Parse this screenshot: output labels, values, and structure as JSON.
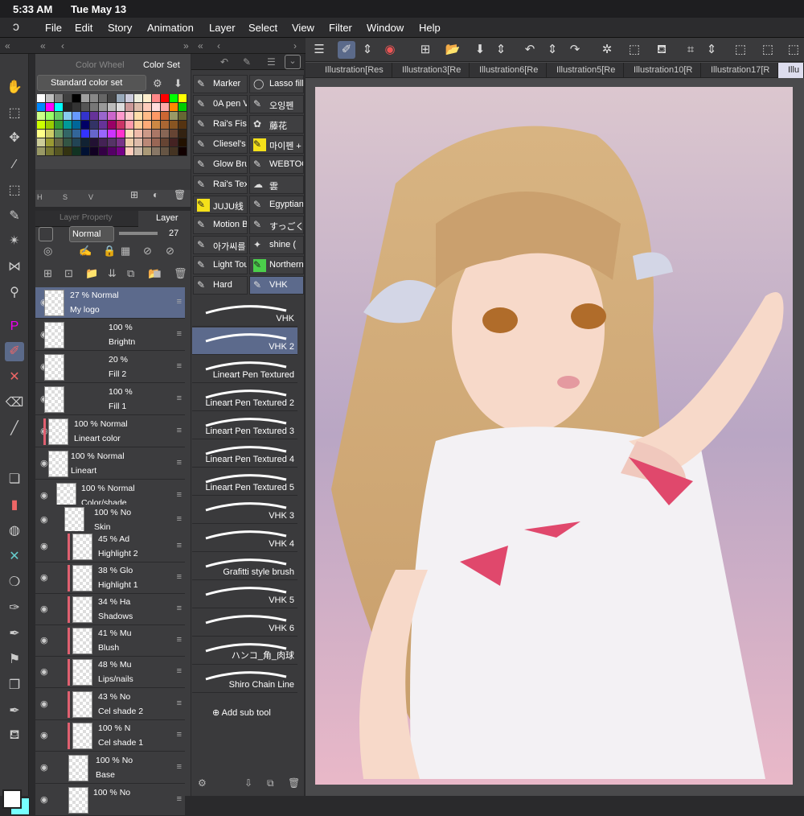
{
  "status": {
    "time": "5:33 AM",
    "date": "Tue May 13"
  },
  "menu": [
    "File",
    "Edit",
    "Story",
    "Animation",
    "Layer",
    "Select",
    "View",
    "Filter",
    "Window",
    "Help"
  ],
  "color_panel": {
    "tabs": [
      {
        "label": "Color Wheel"
      },
      {
        "label": "Color Set"
      }
    ],
    "set_selected": "Standard color set",
    "bottom_labels": [
      "H",
      "S",
      "V"
    ]
  },
  "layer_panel": {
    "tabs": [
      {
        "label": "Layer Property"
      },
      {
        "label": "Layer"
      }
    ],
    "blend_mode": "Normal",
    "opacity": "27",
    "layers": [
      {
        "pct": "27 %  Normal",
        "name": "My logo"
      },
      {
        "pct": "100 %",
        "name": "Brightn"
      },
      {
        "pct": "20 %",
        "name": "Fill 2"
      },
      {
        "pct": "100 %",
        "name": "Fill 1"
      },
      {
        "pct": "100 %  Normal",
        "name": "Lineart color"
      },
      {
        "pct": "100 %  Normal",
        "name": "Lineart"
      },
      {
        "pct": "100 %  Normal",
        "name": "Color/shade"
      },
      {
        "pct": "100 %  No",
        "name": "Skin"
      },
      {
        "pct": "45 %  Ad",
        "name": "Highlight 2"
      },
      {
        "pct": "38 %  Glo",
        "name": "Highlight 1"
      },
      {
        "pct": "34 %  Ha",
        "name": "Shadows"
      },
      {
        "pct": "41 %  Mu",
        "name": "Blush"
      },
      {
        "pct": "48 %  Mu",
        "name": "Lips/nails"
      },
      {
        "pct": "43 %  No",
        "name": "Cel shade 2"
      },
      {
        "pct": "100 %  N",
        "name": "Cel shade 1"
      },
      {
        "pct": "100 %  No",
        "name": "Base"
      },
      {
        "pct": "100 %  No",
        "name": ""
      }
    ]
  },
  "brush_panel": {
    "groups": [
      "Marker",
      "Lasso fill",
      "0A pen V",
      "오잉펜",
      "Rai's Fisl",
      "藤花",
      "Cliesel's",
      "마이펜 +",
      "Glow Bru",
      "WEBTOO",
      "Rai's Tex",
      "雲",
      "JUJU线",
      "Egyptian",
      "Motion B",
      "すっごく",
      "아가씨를",
      "shine (",
      "Light Tou",
      "Northern",
      "Hard",
      "VHK"
    ],
    "strokes": [
      "VHK",
      "VHK 2",
      "Lineart Pen Textured",
      "Lineart Pen Textured 2",
      "Lineart Pen Textured 3",
      "Lineart Pen Textured 4",
      "Lineart Pen Textured 5",
      "VHK 3",
      "VHK 4",
      "Grafitti style brush",
      "VHK 5",
      "VHK 6",
      "ハンコ_角_肉球",
      "Shiro Chain Line"
    ],
    "add_sub_tool": "Add sub tool"
  },
  "doc_tabs": [
    "Illustration[Res",
    "Illustration3[Re",
    "Illustration6[Re",
    "Illustration5[Re",
    "Illustration10[R",
    "Illustration17[R",
    "Illu"
  ]
}
